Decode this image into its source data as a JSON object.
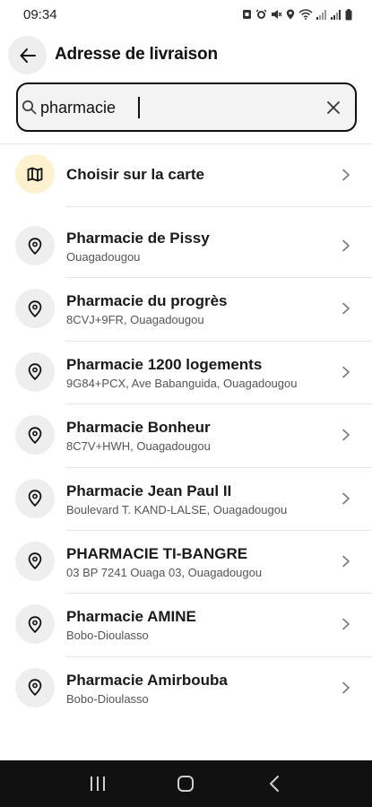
{
  "status_bar": {
    "time": "09:34",
    "icons": [
      "sim-icon",
      "alarm-icon",
      "mute-icon",
      "location-icon",
      "wifi-icon",
      "signal-icon",
      "signal-icon",
      "battery-icon"
    ]
  },
  "header": {
    "title": "Adresse de livraison",
    "back_icon": "arrow-left-icon"
  },
  "search": {
    "value": "pharmacie",
    "icon": "search-icon",
    "clear_icon": "close-icon"
  },
  "map_option": {
    "label": "Choisir sur la carte",
    "icon": "map-icon",
    "icon_bg": "#fdf1cf"
  },
  "results": [
    {
      "title": "Pharmacie de Pissy",
      "subtitle": "Ouagadougou"
    },
    {
      "title": "Pharmacie du progrès",
      "subtitle": "8CVJ+9FR, Ouagadougou"
    },
    {
      "title": "Pharmacie 1200 logements",
      "subtitle": "9G84+PCX, Ave Babanguida, Ouagadougou"
    },
    {
      "title": "Pharmacie Bonheur",
      "subtitle": "8C7V+HWH, Ouagadougou"
    },
    {
      "title": "Pharmacie Jean Paul II",
      "subtitle": "Boulevard T. KAND-LALSE, Ouagadougou"
    },
    {
      "title": "PHARMACIE TI-BANGRE",
      "subtitle": "03 BP 7241 Ouaga 03, Ouagadougou"
    },
    {
      "title": "Pharmacie AMINE",
      "subtitle": "Bobo-Dioulasso"
    },
    {
      "title": "Pharmacie Amirbouba",
      "subtitle": "Bobo-Dioulasso"
    }
  ],
  "nav_bar": {
    "buttons": [
      "recent-apps-icon",
      "home-icon",
      "back-icon"
    ]
  }
}
